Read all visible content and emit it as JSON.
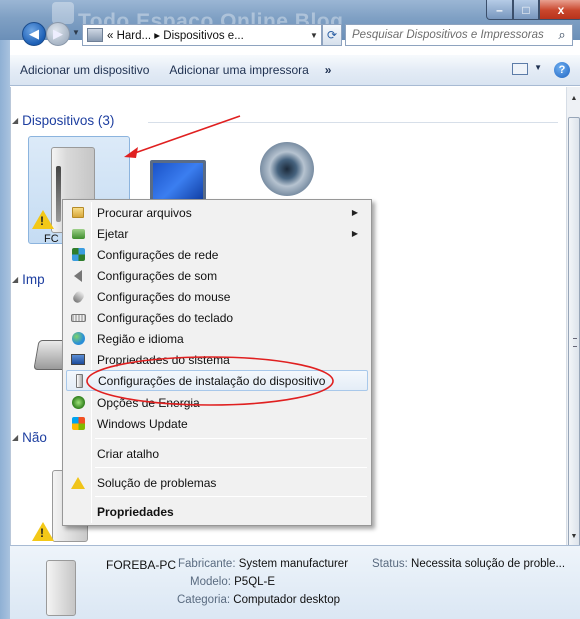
{
  "window": {
    "watermark_title": "Todo Espaço Online Blog",
    "controls": {
      "minimize": "–",
      "maximize": "□",
      "close": "x"
    }
  },
  "address": {
    "path": "« Hard... ▸ Dispositivos e...",
    "search_placeholder": "Pesquisar Dispositivos e Impressoras"
  },
  "toolbar": {
    "add_device": "Adicionar um dispositivo",
    "add_printer": "Adicionar uma impressora",
    "more": "»",
    "help": "?"
  },
  "groups": {
    "devices_header": "Dispositivos (3)",
    "printers_header": "Imp",
    "unspecified_header": "Não",
    "selected_device_label": "FC"
  },
  "context_menu": {
    "items": [
      {
        "label": "Procurar arquivos",
        "icon": "folder-icon",
        "submenu": true
      },
      {
        "label": "Ejetar",
        "icon": "eject-icon",
        "submenu": true
      },
      {
        "label": "Configurações de rede",
        "icon": "network-icon"
      },
      {
        "label": "Configurações de som",
        "icon": "speaker-icon"
      },
      {
        "label": "Configurações do mouse",
        "icon": "mouse-icon"
      },
      {
        "label": "Configurações do teclado",
        "icon": "keyboard-icon"
      },
      {
        "label": "Região e idioma",
        "icon": "globe-icon"
      },
      {
        "label": "Propriedades do sistema",
        "icon": "monitor-icon"
      },
      {
        "label": "Configurações de instalação do dispositivo",
        "icon": "device-icon",
        "highlighted": true
      },
      {
        "label": "Opções de Energia",
        "icon": "power-icon"
      },
      {
        "label": "Windows Update",
        "icon": "windows-update-icon"
      },
      {
        "label": "Criar atalho",
        "icon": ""
      },
      {
        "label": "Solução de problemas",
        "icon": "warning-icon"
      },
      {
        "label": "Propriedades",
        "icon": "",
        "bold": true
      }
    ]
  },
  "details": {
    "name": "FOREBA-PC",
    "manufacturer_label": "Fabricante:",
    "manufacturer_value": "System manufacturer",
    "model_label": "Modelo:",
    "model_value": "P5QL-E",
    "category_label": "Categoria:",
    "category_value": "Computador desktop",
    "status_label": "Status:",
    "status_value": "Necessita solução de proble..."
  },
  "colors": {
    "annotation_red": "#e02020",
    "group_header_blue": "#1e3fa0",
    "selection_tile": "#cfe3f7"
  }
}
